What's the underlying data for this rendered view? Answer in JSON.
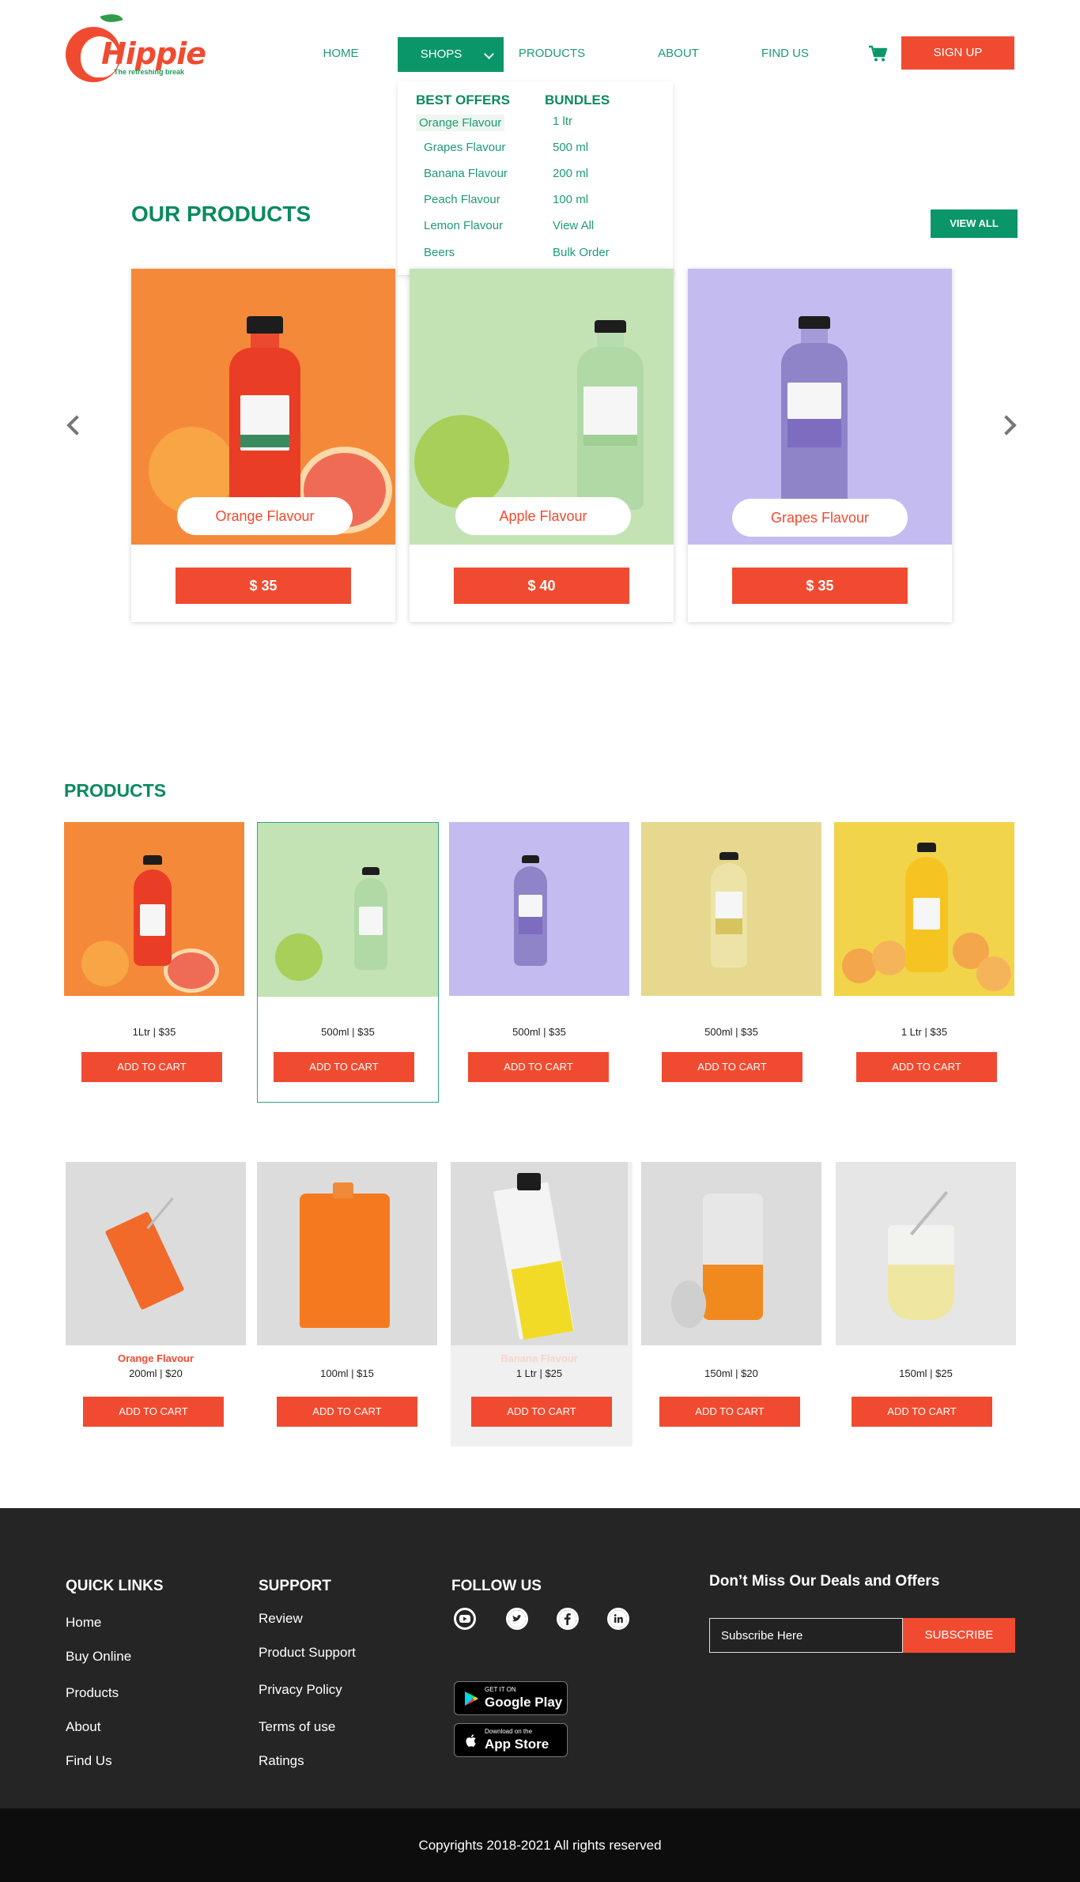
{
  "header": {
    "logo_text": "Hippie",
    "logo_tagline": "The refreshing break",
    "nav": [
      "HOME",
      "SHOPS",
      "PRODUCTS",
      "ABOUT",
      "FIND US"
    ],
    "signup_label": "SIGN UP"
  },
  "dropdown": {
    "col1_head": "BEST OFFERS",
    "col1_items": [
      "Orange Flavour",
      "Grapes Flavour",
      "Banana Flavour",
      "Peach Flavour",
      "Lemon Flavour",
      "Beers"
    ],
    "col2_head": "BUNDLES",
    "col2_items": [
      "1 ltr",
      "500 ml",
      "200 ml",
      "100 ml",
      "View All",
      "Bulk Order"
    ]
  },
  "our_products": {
    "title": "OUR PRODUCTS",
    "view_all": "VIEW ALL",
    "cards": [
      {
        "label": "Orange Flavour",
        "price": "$ 35"
      },
      {
        "label": "Apple Flavour",
        "price": "$ 40"
      },
      {
        "label": "Grapes Flavour",
        "price": "$ 35"
      }
    ]
  },
  "products": {
    "title": "PRODUCTS",
    "row1": [
      {
        "info": "1Ltr  |  $35",
        "button": "ADD TO CART"
      },
      {
        "info": "500ml | $35",
        "button": "ADD TO CART"
      },
      {
        "info": "500ml | $35",
        "button": "ADD TO CART"
      },
      {
        "info": "500ml | $35",
        "button": "ADD TO CART"
      },
      {
        "info": "1 Ltr | $35",
        "button": "ADD TO CART"
      }
    ],
    "row2": [
      {
        "name": "Orange Flavour",
        "info": "200ml | $20",
        "button": "ADD TO CART"
      },
      {
        "name": "",
        "info": "100ml | $15",
        "button": "ADD TO CART"
      },
      {
        "name": "Banana Flavour",
        "info": "1 Ltr | $25",
        "button": "ADD TO CART"
      },
      {
        "name": "",
        "info": "150ml | $20",
        "button": "ADD TO CART"
      },
      {
        "name": "",
        "info": "150ml | $25",
        "button": "ADD TO CART"
      }
    ]
  },
  "footer": {
    "quick_links_head": "QUICK LINKS",
    "quick_links": [
      "Home",
      "Buy Online",
      "Products",
      "About",
      "Find Us"
    ],
    "support_head": "SUPPORT",
    "support": [
      "Review",
      "Product Support",
      "Privacy Policy",
      "Terms of use",
      "Ratings"
    ],
    "follow_head": "FOLLOW US",
    "social_icons": [
      "youtube-icon",
      "twitter-icon",
      "facebook-icon",
      "linkedin-icon"
    ],
    "google_play_small": "GET IT ON",
    "google_play_big": "Google Play",
    "app_store_small": "Download on the",
    "app_store_big": "App Store",
    "deals_head": "Don’t Miss Our Deals and Offers",
    "subscribe_placeholder": "Subscribe Here",
    "subscribe_button": "SUBSCRIBE",
    "copyright": "Copyrights 2018-2021 All rights reserved"
  },
  "colors": {
    "brand_green": "#0a9669",
    "accent_red": "#f04b30",
    "footer_bg": "#252525"
  }
}
